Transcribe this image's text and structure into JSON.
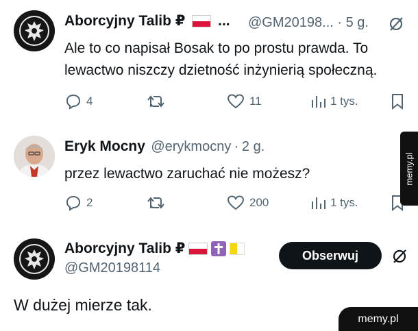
{
  "tweets": [
    {
      "display_name": "Aborcyjny Talib ₽",
      "handle": "@GM20198...",
      "sep": "·",
      "time": "5 g.",
      "text_line1": "Ale to co napisał Bosak to po prostu prawda. To",
      "text_line2": "lewactwo niszczy dzietność inżynierią społeczną.",
      "name_suffix": "...",
      "replies": "4",
      "likes": "11",
      "views": "1 tys."
    },
    {
      "display_name": "Eryk Mocny",
      "handle": "@erykmocny",
      "sep": "·",
      "time": "2 g.",
      "text": "przez lewactwo zaruchać nie możesz?",
      "replies": "2",
      "likes": "200",
      "views": "1 tys."
    }
  ],
  "main_tweet": {
    "display_name": "Aborcyjny Talib ₽",
    "handle": "@GM20198114",
    "follow_label": "Obserwuj",
    "text": "W dużej mierze tak."
  },
  "watermark": "memy.pl",
  "side_watermark": "memy.pl",
  "icons": [
    "grok-icon",
    "reply-icon",
    "retweet-icon",
    "like-icon",
    "views-icon",
    "bookmark-icon",
    "cross-icon",
    "poland-flag-icon",
    "vatican-flag-icon"
  ]
}
